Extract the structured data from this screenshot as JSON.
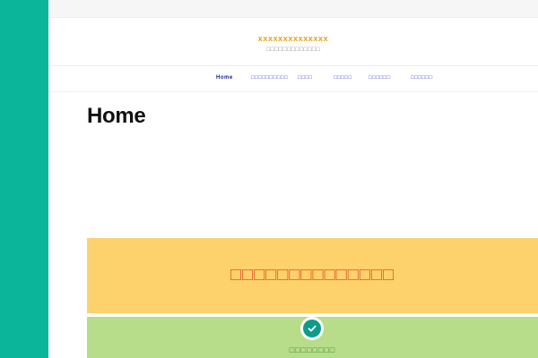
{
  "site": {
    "title": "xxxxxxxxxxxxxx",
    "tagline": "□□□□□□□□□□□□□"
  },
  "nav": {
    "items": [
      {
        "label": "Home",
        "active": true
      },
      {
        "label": "□□□□□□□□□□"
      },
      {
        "label": "□□□□"
      },
      {
        "label": "□□□□□"
      },
      {
        "label": "□□□□□□"
      },
      {
        "label": "□□□□□□"
      }
    ]
  },
  "main": {
    "page_title": "Home"
  },
  "blocks": {
    "yellow_text": "□□□□□□□□□□□□□□",
    "green_text": "□□□□□□□□"
  },
  "colors": {
    "sidebar": "#0bb59a",
    "title_accent": "#e8a21c",
    "nav_link": "#3a3ad8",
    "yellow_block": "#fdd16b",
    "yellow_text": "#e2552a",
    "green_block": "#b7dc8a",
    "green_text": "#2f8f2a",
    "check_badge": "#0e9b8a"
  },
  "icons": {
    "check": "checkmark-circle-icon"
  }
}
